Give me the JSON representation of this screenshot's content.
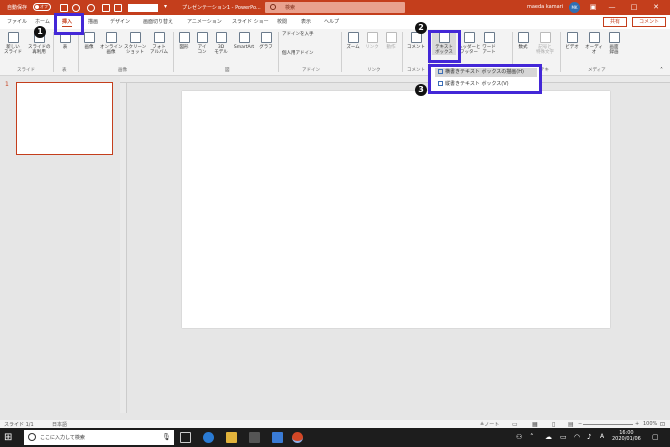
{
  "titlebar": {
    "autosave_label": "自動保存",
    "autosave_state": "オフ",
    "doc_title": "プレゼンテーション1 - PowerPo...",
    "search_placeholder": "検索",
    "user_name": "maeda kamari",
    "avatar_initials": "MK",
    "minimize": "—",
    "restore": "□",
    "close": "✕"
  },
  "tabs": [
    "ファイル",
    "ホーム",
    "挿入",
    "描画",
    "デザイン",
    "画面切り替え",
    "アニメーション",
    "スライド ショー",
    "校閲",
    "表示",
    "ヘルプ"
  ],
  "share_label": "共有",
  "comment_label": "コメント",
  "ribbon": {
    "buttons": {
      "new_slide": "新しい\nスライド",
      "reuse_slide": "スライドの\n再利用",
      "table": "表",
      "image": "画像",
      "online_image": "オンライン\n画像",
      "screenshot": "スクリーン\nショット",
      "photo_album": "フォト\nアルバム",
      "shapes": "図形",
      "icons": "アイ\nコン",
      "model3d": "3D\nモデル",
      "smartart": "SmartArt",
      "graph": "グラフ",
      "get_addin": "アドインを入手",
      "my_addin": "個人用アドイン",
      "zoom": "ズーム",
      "link": "リンク",
      "action": "動作",
      "comment": "コメント",
      "textbox": "テキスト\nボックス",
      "header_footer": "ヘッダーと\nフッター",
      "wordart": "ワード\nアート",
      "formula": "数式",
      "symbol": "記号と\n特殊文字",
      "video": "ビデオ",
      "audio": "オーディオ",
      "screen_record": "画面\n録画"
    },
    "groups": {
      "slide": "スライド",
      "table": "表",
      "image": "画像",
      "figure": "図",
      "addin": "アドイン",
      "link": "リンク",
      "comment": "コメント",
      "text": "テキ",
      "symbol": "記号と特殊文字",
      "media": "メディア"
    }
  },
  "dropdown": {
    "items": [
      "横書きテキスト ボックスの描画(H)",
      "縦書きテキスト ボックス(V)"
    ]
  },
  "annotations": [
    "1",
    "2",
    "3"
  ],
  "slide_panel": {
    "slide_number": "1"
  },
  "statusbar": {
    "slide_info": "スライド 1/1",
    "language": "日本語",
    "notes": "≜ノート",
    "zoom": "100%"
  },
  "taskbar": {
    "search_placeholder": "ここに入力して検索",
    "time": "16:00",
    "date": "2020/01/06"
  },
  "colors": {
    "accent": "#c43e1c",
    "highlight": "#4327d7"
  }
}
